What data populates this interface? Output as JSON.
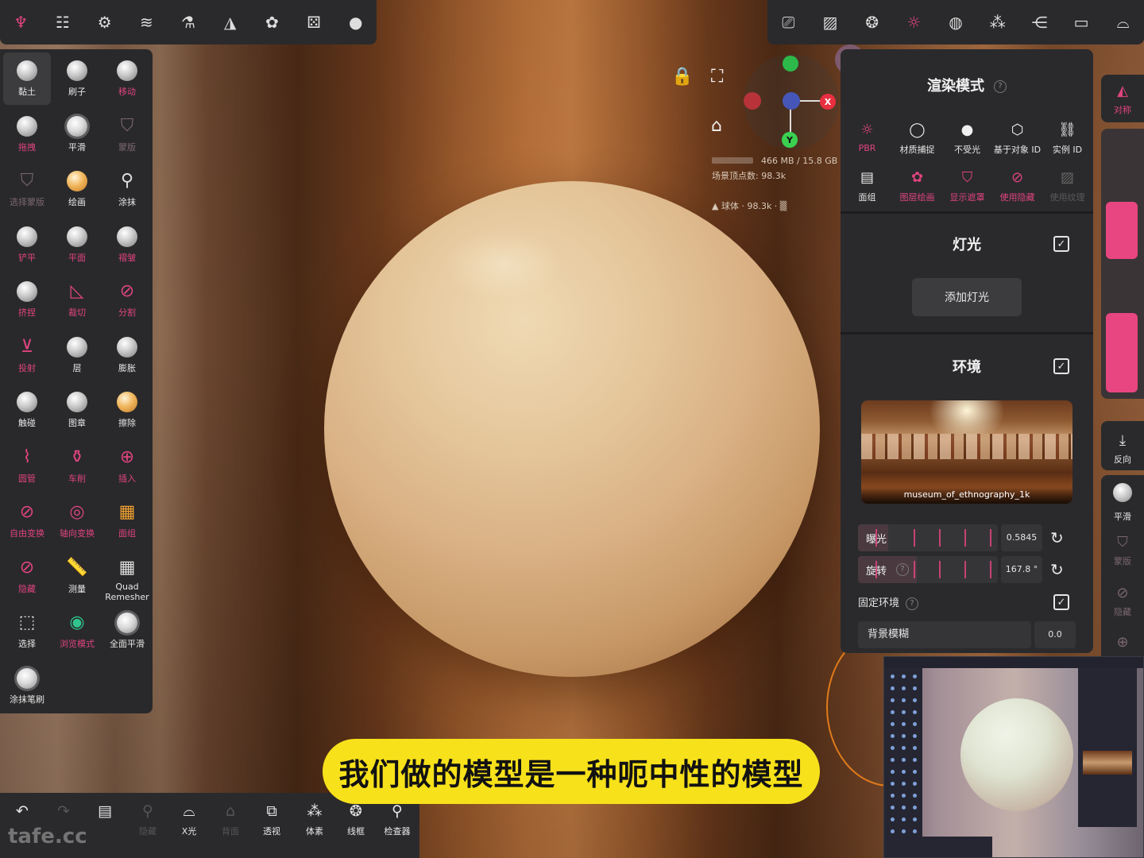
{
  "top_left_toolbar": {
    "buttons": [
      {
        "name": "scene-icon",
        "glyph": "♆",
        "accent": true
      },
      {
        "name": "sliders-icon",
        "glyph": "☷"
      },
      {
        "name": "settings-icon",
        "glyph": "⚙"
      },
      {
        "name": "layers-icon",
        "glyph": "≋"
      },
      {
        "name": "flask-icon",
        "glyph": "⚗"
      },
      {
        "name": "symmetry-icon",
        "glyph": "◮"
      },
      {
        "name": "palette-icon",
        "glyph": "✿"
      },
      {
        "name": "dice-icon",
        "glyph": "⚄"
      },
      {
        "name": "material-ball-icon",
        "glyph": "●"
      }
    ]
  },
  "top_right_toolbar": {
    "buttons": [
      {
        "name": "camera-icon",
        "glyph": "⎚"
      },
      {
        "name": "image-icon",
        "glyph": "▨"
      },
      {
        "name": "aperture-icon",
        "glyph": "❂"
      },
      {
        "name": "sun-icon",
        "glyph": "☼",
        "accent": true
      },
      {
        "name": "sphere-grid-icon",
        "glyph": "◍"
      },
      {
        "name": "molecule-icon",
        "glyph": "⁂"
      },
      {
        "name": "share-icon",
        "glyph": "⋲"
      },
      {
        "name": "folder-icon",
        "glyph": "▭"
      },
      {
        "name": "shoe-icon",
        "glyph": "⌓"
      }
    ]
  },
  "tools": [
    {
      "label": "黏土",
      "icon": "ball",
      "active": true
    },
    {
      "label": "刷子",
      "icon": "ball"
    },
    {
      "label": "移动",
      "icon": "ball",
      "style": "red"
    },
    {
      "label": "拖拽",
      "icon": "ball",
      "style": "red"
    },
    {
      "label": "平滑",
      "icon": "spiky"
    },
    {
      "label": "蒙版",
      "glyph": "⛉",
      "style": "dim"
    },
    {
      "label": "选择蒙版",
      "glyph": "⛉",
      "style": "dim"
    },
    {
      "label": "绘画",
      "icon": "orange"
    },
    {
      "label": "涂抹",
      "glyph": "⚲"
    },
    {
      "label": "铲平",
      "icon": "ball",
      "style": "red"
    },
    {
      "label": "平面",
      "icon": "ball",
      "style": "red"
    },
    {
      "label": "褶皱",
      "icon": "ball",
      "style": "red"
    },
    {
      "label": "挤捏",
      "icon": "ball",
      "style": "red"
    },
    {
      "label": "裁切",
      "glyph": "◺",
      "style": "red"
    },
    {
      "label": "分割",
      "glyph": "⊘",
      "style": "red"
    },
    {
      "label": "投射",
      "glyph": "⊻",
      "style": "red"
    },
    {
      "label": "层",
      "icon": "ball"
    },
    {
      "label": "膨胀",
      "icon": "ball"
    },
    {
      "label": "触碰",
      "icon": "ball"
    },
    {
      "label": "图章",
      "icon": "ball"
    },
    {
      "label": "擦除",
      "icon": "orange"
    },
    {
      "label": "圆管",
      "glyph": "⌇",
      "style": "red"
    },
    {
      "label": "车削",
      "glyph": "⚱",
      "style": "red"
    },
    {
      "label": "插入",
      "glyph": "⊕",
      "style": "red"
    },
    {
      "label": "自由变换",
      "glyph": "⊘",
      "style": "red"
    },
    {
      "label": "轴向变换",
      "glyph": "◎",
      "style": "red"
    },
    {
      "label": "面组",
      "glyph": "▦",
      "style": "orange"
    },
    {
      "label": "隐藏",
      "glyph": "⊘",
      "style": "red"
    },
    {
      "label": "测量",
      "glyph": "📏"
    },
    {
      "label": "Quad Remesher",
      "glyph": "▦"
    },
    {
      "label": "选择",
      "glyph": "⬚"
    },
    {
      "label": "浏览模式",
      "glyph": "◉",
      "style": "green"
    },
    {
      "label": "全面平滑",
      "icon": "spiky"
    },
    {
      "label": "涂抹笔刷",
      "icon": "spiky"
    }
  ],
  "viewport": {
    "lock_icon": "🔒",
    "fullscreen_icon": "⛶",
    "home_icon": "⌂",
    "axis_x": "X",
    "axis_y": "Y",
    "memory": "466 MB / 15.8 GB",
    "scene_vertices": "场景顶点数: 98.3k",
    "object_info": "▲ 球体 · 98.3k · ▒",
    "pin_icon": "📌"
  },
  "render_panel": {
    "title": "渲染模式",
    "help": "?",
    "modes_row1": [
      {
        "label": "PBR",
        "glyph": "☼",
        "style": "red"
      },
      {
        "label": "材质捕捉",
        "glyph": "◯"
      },
      {
        "label": "不受光",
        "glyph": "●"
      },
      {
        "label": "基于对象 ID",
        "glyph": "⬡"
      },
      {
        "label": "实例 ID",
        "glyph": "⛓"
      }
    ],
    "modes_row2": [
      {
        "label": "面组",
        "glyph": "▤"
      },
      {
        "label": "图层绘画",
        "glyph": "✿",
        "style": "red"
      },
      {
        "label": "显示遮罩",
        "glyph": "⛉",
        "style": "red"
      },
      {
        "label": "使用隐藏",
        "glyph": "⊘",
        "style": "red"
      },
      {
        "label": "使用纹理",
        "glyph": "▨",
        "style": "dim"
      }
    ],
    "lights": {
      "title": "灯光",
      "checked": "✓",
      "add_button": "添加灯光"
    },
    "environment": {
      "title": "环境",
      "checked": "✓",
      "hdri_name": "museum_of_ethnography_1k",
      "exposure_label": "曝光",
      "exposure_value": "0.5845",
      "rotation_label": "旋转",
      "rotation_value": "167.8 °",
      "fixed_env_label": "固定环境",
      "fixed_env_checked": "✓",
      "blur_label": "背景模糊",
      "blur_value": "0.0",
      "reset_icon": "↻"
    }
  },
  "right_strip": {
    "symmetry_label": "对称",
    "symmetry_glyph": "◭",
    "reverse_label": "反向",
    "reverse_glyph": "⤓",
    "smooth_label": "平滑",
    "mask_label": "蒙版",
    "mask_glyph": "⛉",
    "hide_label": "隐藏",
    "hide_glyph": "⊘",
    "extra_glyph": "⊕"
  },
  "bottom_bar": {
    "items": [
      {
        "label": "",
        "glyph": "↶"
      },
      {
        "label": "",
        "glyph": "↷",
        "dim": true
      },
      {
        "label": "",
        "glyph": "▤"
      },
      {
        "label": "隐藏",
        "glyph": "⚲",
        "dim": true
      },
      {
        "label": "X光",
        "glyph": "⌓"
      },
      {
        "label": "背面",
        "glyph": "⌂",
        "dim": true
      },
      {
        "label": "透视",
        "glyph": "⧉"
      },
      {
        "label": "体素",
        "glyph": "⁂"
      },
      {
        "label": "线框",
        "glyph": "❂"
      },
      {
        "label": "检查器",
        "glyph": "⚲"
      }
    ],
    "watermark": "tafe.cc"
  },
  "subtitle": "我们做的模型是一种呃中性的模型"
}
